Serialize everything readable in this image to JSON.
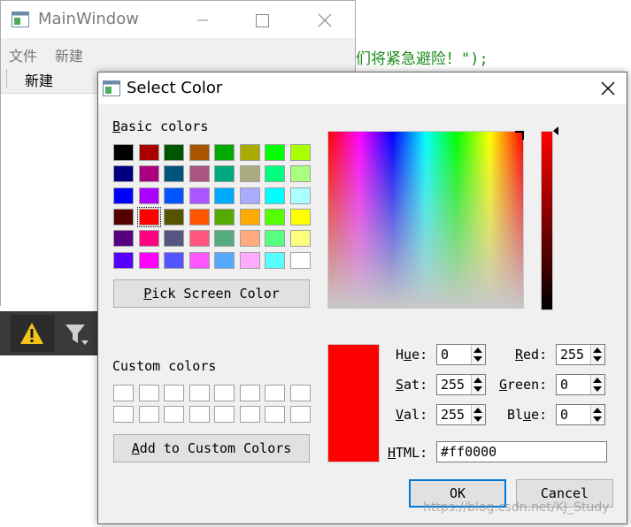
{
  "main_window": {
    "title": "MainWindow",
    "menu": [
      "文件",
      "新建"
    ],
    "toolbar_action": "新建"
  },
  "background_code": "们将紧急避险！\");",
  "dialog": {
    "title": "Select Color",
    "basic_colors_label": {
      "pre": "",
      "accel": "B",
      "post": "asic colors"
    },
    "custom_colors_label": "Custom colors",
    "basic_colors": [
      [
        "#000000",
        "#aa0000",
        "#005500",
        "#aa5500",
        "#00aa00",
        "#aaaa00",
        "#00ff00",
        "#aaff00"
      ],
      [
        "#00007f",
        "#aa007f",
        "#00557f",
        "#aa557f",
        "#00aa7f",
        "#aaaa7f",
        "#00ff7f",
        "#aaff7f"
      ],
      [
        "#0000ff",
        "#aa00ff",
        "#0055ff",
        "#aa55ff",
        "#00aaff",
        "#aaaaff",
        "#00ffff",
        "#aaffff"
      ],
      [
        "#550000",
        "#ff0000",
        "#555500",
        "#ff5500",
        "#55aa00",
        "#ffaa00",
        "#55ff00",
        "#ffff00"
      ],
      [
        "#55007f",
        "#ff007f",
        "#55557f",
        "#ff557f",
        "#55aa7f",
        "#ffaa7f",
        "#55ff7f",
        "#ffff7f"
      ],
      [
        "#5500ff",
        "#ff00ff",
        "#5555ff",
        "#ff55ff",
        "#55aaff",
        "#ffaaff",
        "#55ffff",
        "#ffffff"
      ]
    ],
    "selected_swatch": {
      "row": 3,
      "col": 1
    },
    "pick_screen_button": {
      "pre": "",
      "accel": "P",
      "post": "ick Screen Color"
    },
    "add_custom_button": {
      "pre": "",
      "accel": "A",
      "post": "dd to Custom Colors"
    },
    "current_color": "#ff0000",
    "fields": {
      "hue": {
        "accel": "u",
        "pre": "H",
        "post": "e:",
        "value": "0"
      },
      "sat": {
        "accel": "S",
        "pre": "",
        "post": "at:",
        "value": "255"
      },
      "val": {
        "accel": "V",
        "pre": "",
        "post": "al:",
        "value": "255"
      },
      "red": {
        "accel": "R",
        "pre": "",
        "post": "ed:",
        "value": "255"
      },
      "green": {
        "accel": "G",
        "pre": "",
        "post": "reen:",
        "value": "0"
      },
      "blue": {
        "accel": "u",
        "pre": "Bl",
        "post": "e:",
        "value": "0"
      }
    },
    "html_label": {
      "pre": "",
      "accel": "H",
      "post": "TML:"
    },
    "html_value": "#ff0000",
    "ok_label": "OK",
    "cancel_label": "Cancel"
  },
  "watermark": "https://blog.csdn.net/KJ_Study"
}
